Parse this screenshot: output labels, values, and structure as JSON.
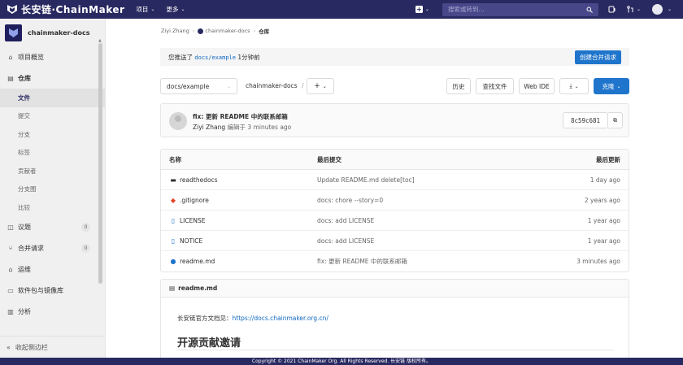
{
  "topbar": {
    "logo_text": "长安链·ChainMaker",
    "nav": [
      {
        "label": "项目"
      },
      {
        "label": "更多"
      }
    ],
    "plus_glyph": "+",
    "search_placeholder": "搜索或转到..."
  },
  "sidebar": {
    "project_name": "chainmaker-docs",
    "items": [
      {
        "label": "项目概览",
        "icon": "home-icon"
      },
      {
        "label": "仓库",
        "icon": "doc-icon"
      }
    ],
    "repo_sub": [
      {
        "label": "文件"
      },
      {
        "label": "提交"
      },
      {
        "label": "分支"
      },
      {
        "label": "标签"
      },
      {
        "label": "贡献者"
      },
      {
        "label": "分支图"
      },
      {
        "label": "比较"
      }
    ],
    "items2": [
      {
        "label": "议题",
        "badge": "0",
        "icon": "issues-icon"
      },
      {
        "label": "合并请求",
        "badge": "0",
        "icon": "merge-icon"
      },
      {
        "label": "运维",
        "icon": "rocket-icon"
      },
      {
        "label": "软件包与镜像库",
        "icon": "package-icon"
      },
      {
        "label": "分析",
        "icon": "chart-icon"
      }
    ],
    "collapse": "收起侧边栏"
  },
  "breadcrumb": {
    "user": "Ziyi Zhang",
    "project": "chainmaker-docs",
    "current": "仓库"
  },
  "alert": {
    "prefix": "您推送了",
    "branch": "docs/example",
    "suffix": "1分钟前",
    "button": "创建合并请求"
  },
  "toolbar": {
    "branch": "docs/example",
    "path": "chainmaker-docs",
    "path_sep": "/",
    "history": "历史",
    "find_file": "查找文件",
    "web_ide": "Web IDE",
    "clone": "克隆"
  },
  "commit": {
    "title": "fix: 更新 README 中的联系邮箱",
    "author": "Ziyi Zhang",
    "edited": "编辑于 3 minutes ago",
    "sha": "8c59c681"
  },
  "table": {
    "headers": {
      "name": "名称",
      "last_commit": "最后提交",
      "last_update": "最后更新"
    },
    "rows": [
      {
        "name": "readthedocs",
        "commit": "Update README.md delete[toc]",
        "updated": "1 day ago",
        "icon": "folder-icon"
      },
      {
        "name": ".gitignore",
        "commit": "docs: chore --story=0",
        "updated": "2 years ago",
        "icon": "git-icon"
      },
      {
        "name": "LICENSE",
        "commit": "docs: add LICENSE",
        "updated": "1 year ago",
        "icon": "file-icon"
      },
      {
        "name": "NOTICE",
        "commit": "docs: add LICENSE",
        "updated": "1 year ago",
        "icon": "file-icon"
      },
      {
        "name": "readme.md",
        "commit": "fix: 更新 README 中的联系邮箱",
        "updated": "3 minutes ago",
        "icon": "info-icon"
      }
    ]
  },
  "readme": {
    "title": "readme.md",
    "line_prefix": "长安链官方文档见：",
    "link": "https://docs.chainmaker.org.cn/",
    "heading": "开源贡献邀请"
  },
  "footer": "Copyright © 2021 ChainMaker Org. All Rights Reserved. 长安链 版权所有。",
  "colors": {
    "header": "#292961",
    "primary": "#1f75cb",
    "link": "#1068bf"
  }
}
